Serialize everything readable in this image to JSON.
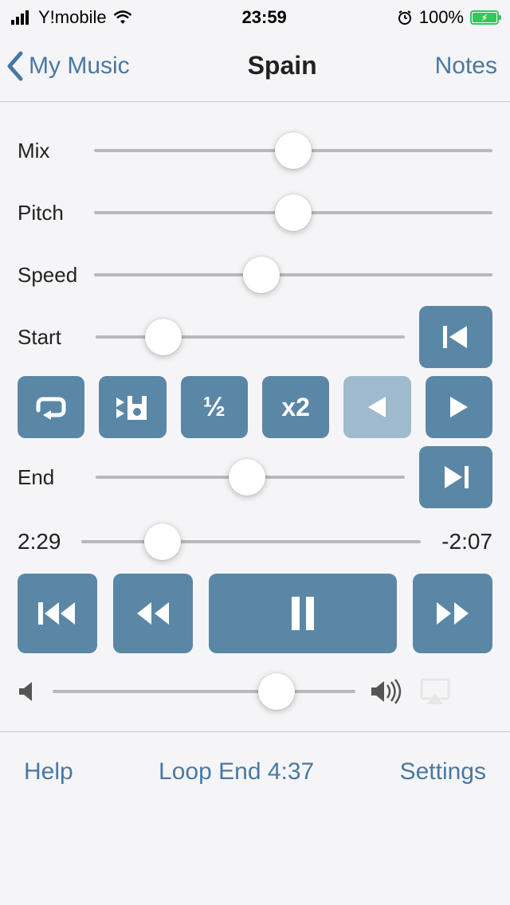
{
  "status": {
    "carrier": "Y!mobile",
    "time": "23:59",
    "battery_pct": "100%"
  },
  "nav": {
    "back_label": "My Music",
    "title": "Spain",
    "right": "Notes"
  },
  "sliders": {
    "mix": {
      "label": "Mix",
      "pct": 50
    },
    "pitch": {
      "label": "Pitch",
      "pct": 50
    },
    "speed": {
      "label": "Speed",
      "pct": 42
    },
    "start": {
      "label": "Start",
      "pct": 22
    },
    "end": {
      "label": "End",
      "pct": 49
    }
  },
  "tools": {
    "half_label": "½",
    "double_label": "x2"
  },
  "playhead": {
    "elapsed": "2:29",
    "remaining": "-2:07",
    "pct": 24
  },
  "volume": {
    "pct": 74
  },
  "footer": {
    "help": "Help",
    "status": "Loop End 4:37",
    "settings": "Settings"
  }
}
